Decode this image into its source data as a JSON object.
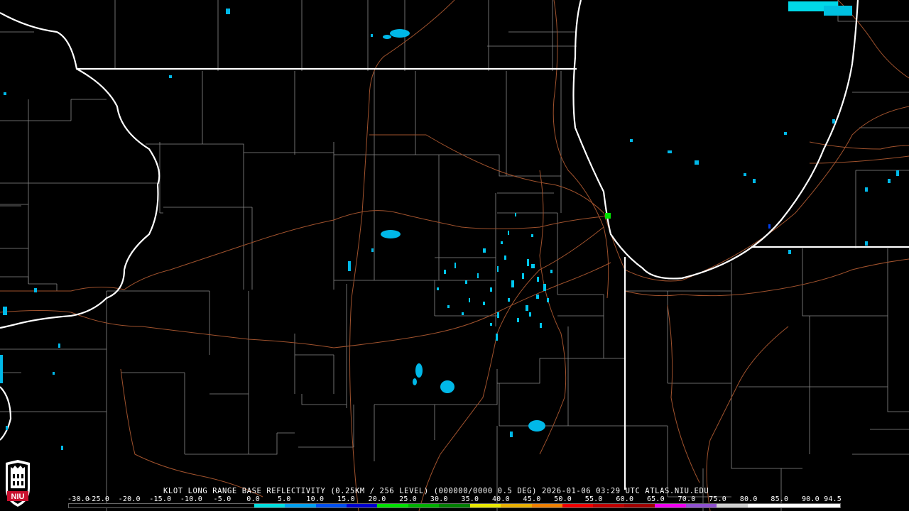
{
  "product_title": "KLOT LONG RANGE BASE REFLECTIVITY (0.25KM / 256 LEVEL) (000000/0000 0.5 DEG) 2026-01-06 03:29 UTC  ATLAS.NIU.EDU",
  "scale": {
    "labels": [
      "-30.0",
      "-25.0",
      "-20.0",
      "-15.0",
      "-10.0",
      "-5.0",
      "0.0",
      "5.0",
      "10.0",
      "15.0",
      "20.0",
      "25.0",
      "30.0",
      "35.0",
      "40.0",
      "45.0",
      "50.0",
      "55.0",
      "60.0",
      "65.0",
      "70.0",
      "75.0",
      "80.0",
      "85.0",
      "90.0",
      "94.5"
    ],
    "colors": [
      "#000000",
      "#000000",
      "#000000",
      "#000000",
      "#000000",
      "#000000",
      "#00e0e0",
      "#00a0f0",
      "#0050f0",
      "#0000d0",
      "#00e000",
      "#00b000",
      "#008000",
      "#e8e800",
      "#e8b000",
      "#f08000",
      "#f00000",
      "#c00000",
      "#a00000",
      "#f000f0",
      "#9050d0",
      "#d0d0d0",
      "#ffffff",
      "#ffffff",
      "#ffffff"
    ]
  },
  "logo": {
    "text": "NIU"
  }
}
